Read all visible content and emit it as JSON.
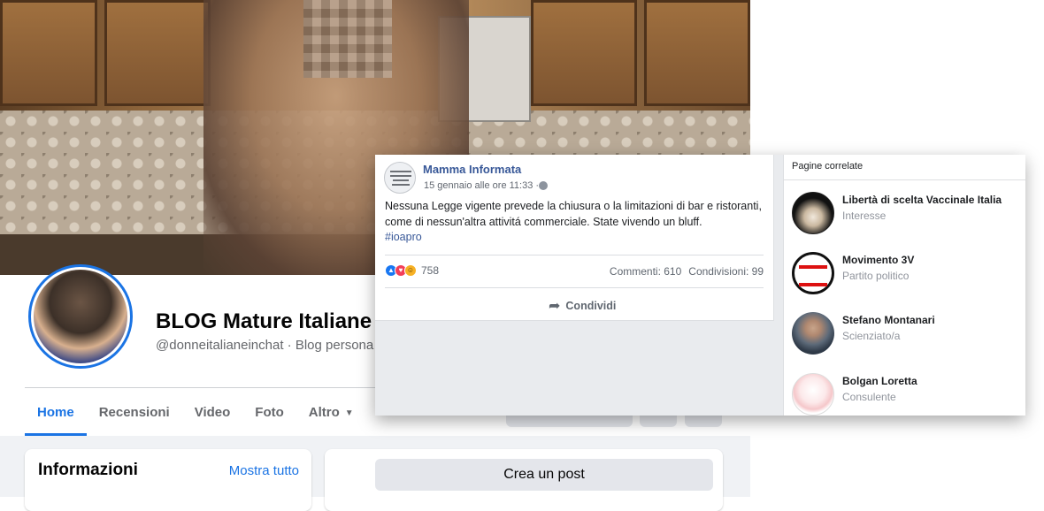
{
  "page": {
    "name": "BLOG Mature Italiane",
    "handle_line": "@donneitalianeinchat · Blog persona"
  },
  "tabs": [
    {
      "label": "Home"
    },
    {
      "label": "Recensioni"
    },
    {
      "label": "Video"
    },
    {
      "label": "Foto"
    },
    {
      "label": "Altro"
    }
  ],
  "info_card": {
    "title": "Informazioni",
    "link": "Mostra tutto"
  },
  "composer": {
    "button": "Crea un post"
  },
  "post": {
    "author": "Mamma Informata",
    "timestamp": "15 gennaio alle ore 11:33 ·",
    "text": "Nessuna Legge vigente prevede la chiusura o la limitazioni di bar e ristoranti, come di nessun'altra attivitá commerciale. State vivendo un bluff.",
    "hashtag": "#ioapro",
    "reactions": {
      "icons": [
        "like-icon",
        "love-icon",
        "haha-icon"
      ],
      "count": "758"
    },
    "comments": "Commenti: 610",
    "shares": "Condivisioni: 99",
    "share_button": "Condividi"
  },
  "related_pages": {
    "header": "Pagine correlate",
    "items": [
      {
        "name": "Libertà di scelta Vaccinale Italia",
        "category": "Interesse"
      },
      {
        "name": "Movimento 3V",
        "category": "Partito politico"
      },
      {
        "name": "Stefano Montanari",
        "category": "Scienziato/a"
      },
      {
        "name": "Bolgan Loretta",
        "category": "Consulente"
      }
    ]
  },
  "colors": {
    "accent": "#1b74e4",
    "link_blue": "#385898",
    "background": "#f0f2f5"
  }
}
